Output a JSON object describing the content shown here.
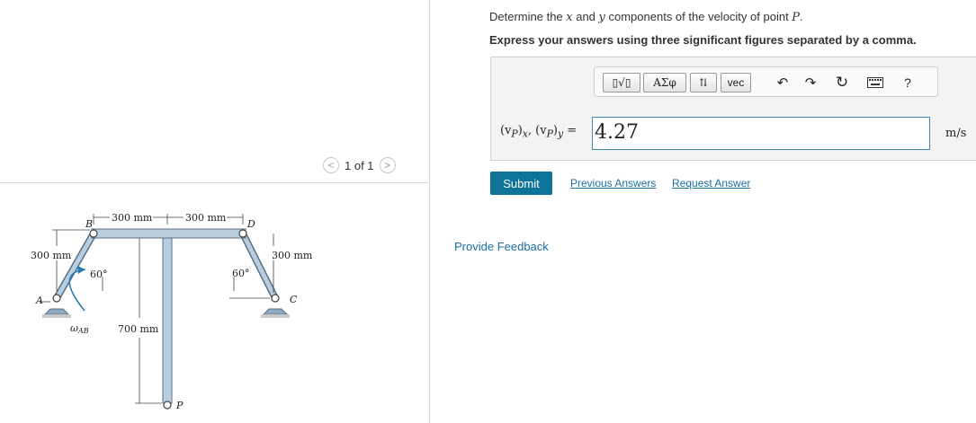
{
  "pager": {
    "text": "1 of 1",
    "prev_glyph": "<",
    "next_glyph": ">"
  },
  "figure": {
    "dim_ab": "300 mm",
    "dim_bd": "300 mm",
    "dim_left": "300 mm",
    "dim_right": "300 mm",
    "dim_stem": "700 mm",
    "angle_left": "60°",
    "angle_right": "60°",
    "label_a": "A",
    "label_b": "B",
    "label_c": "C",
    "label_d": "D",
    "label_p": "P",
    "omega_symbol": "ω",
    "omega_sub": "AB"
  },
  "question": {
    "prefix": "Determine the ",
    "var_x": "x",
    "middle": " and ",
    "var_y": "y",
    "suffix": " components of the velocity of point ",
    "point": "P",
    "end": "."
  },
  "instruction": "Express your answers using three significant figures separated by a comma.",
  "toolbar": {
    "templates_label": "▯√▯",
    "greek_label": "ΑΣφ",
    "updown_label": "⇅",
    "vec_label": "vec",
    "help_label": "?",
    "icons": [
      "undo-icon",
      "redo-icon",
      "reset-icon",
      "keyboard-icon"
    ]
  },
  "answer": {
    "label_vp": "(v",
    "label_p": "P",
    "label_x": "x",
    "label_y": "y",
    "label_eq": " =",
    "value": "4.27",
    "unit": "m/s"
  },
  "actions": {
    "submit": "Submit",
    "previous_answers": "Previous Answers",
    "request_answer": "Request Answer"
  },
  "feedback": "Provide Feedback",
  "colors": {
    "accent": "#0e7399",
    "link": "#1b6ea3",
    "figure_bar": "#b7cde0",
    "figure_outline": "#5b6f82"
  }
}
